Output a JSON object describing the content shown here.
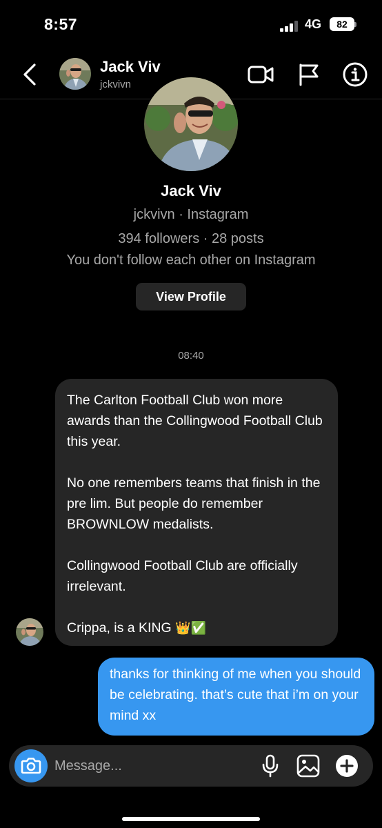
{
  "status_bar": {
    "time": "8:57",
    "network": "4G",
    "battery": "82"
  },
  "header": {
    "name": "Jack Viv",
    "handle": "jckvivn"
  },
  "profile": {
    "name": "Jack Viv",
    "subtitle": "jckvivn · Instagram",
    "stats": "394 followers · 28 posts",
    "relationship": "You don't follow each other on Instagram",
    "view_profile_label": "View Profile"
  },
  "thread": {
    "timestamp": "08:40",
    "incoming": {
      "para1": "The Carlton Football Club won more awards than the Collingwood Football Club this year.",
      "para2": "No one remembers teams that finish in the pre lim. But people do remember BROWNLOW medalists.",
      "para3": "Collingwood Football Club are officially irrelevant.",
      "para4": "Crippa, is a KING",
      "emoji": "👑✅"
    },
    "outgoing": {
      "text": "thanks for thinking of me when you should be celebrating. that’s cute that i’m on your mind xx"
    }
  },
  "composer": {
    "placeholder": "Message..."
  },
  "colors": {
    "accent": "#3797f0",
    "bubble_incoming": "#262626",
    "background": "#000000"
  },
  "icons": [
    "back-icon",
    "video-camera-icon",
    "flag-icon",
    "info-icon",
    "camera-icon",
    "microphone-icon",
    "gallery-icon",
    "add-icon"
  ]
}
